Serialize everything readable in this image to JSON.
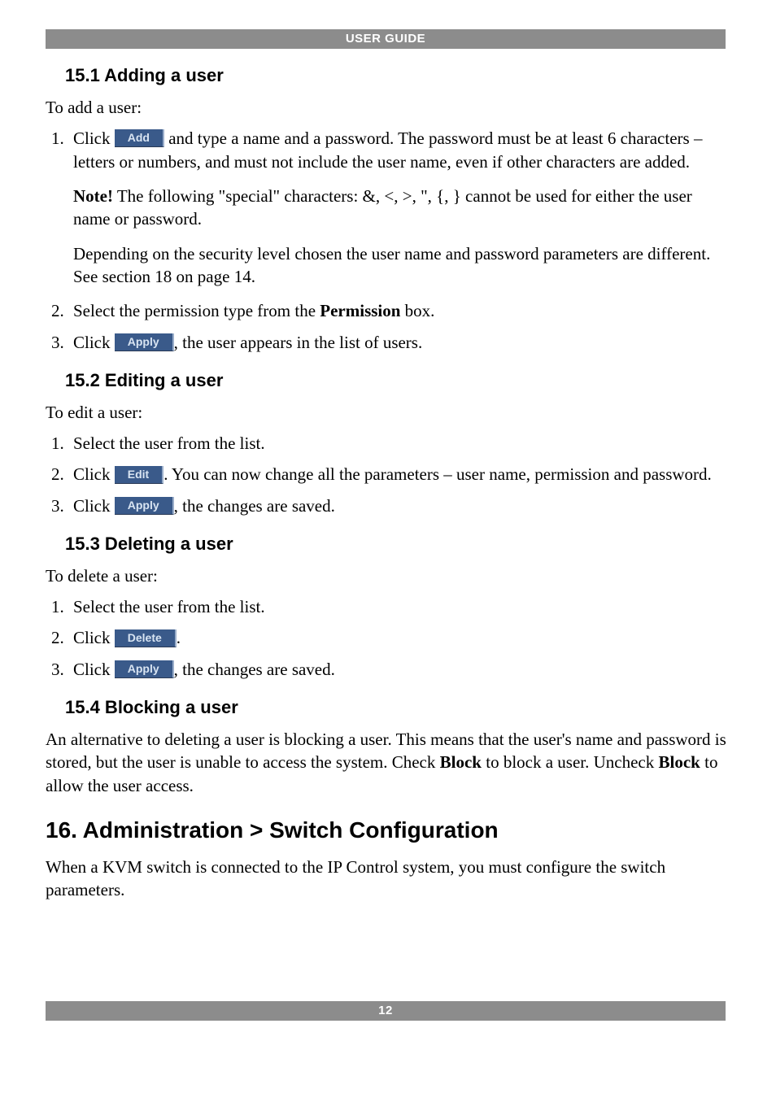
{
  "header": "USER GUIDE",
  "footer_page": "12",
  "s151": {
    "title": "15.1 Adding a user",
    "intro": "To add a user:",
    "step1_a": "Click ",
    "btn_add": "Add",
    "step1_b": " and type a name and a password. The password must be at least 6 characters – letters or numbers, and must not include the user name, even if other characters are added.",
    "note_label": "Note!",
    "note_body": " The following \"special\" characters: &, <, >, \", {, } cannot be used for either the user name or password.",
    "depend": "Depending on the security level chosen the user name and password parameters are different. See section 18 on page 14.",
    "step2_a": "Select the permission type from the ",
    "step2_perm": "Permission",
    "step2_b": " box.",
    "step3_a": "Click ",
    "btn_apply": "Apply",
    "step3_b": ", the user appears in the list of users."
  },
  "s152": {
    "title": "15.2 Editing a user",
    "intro": "To edit a user:",
    "step1": "Select the user from the list.",
    "step2_a": "Click ",
    "btn_edit": "Edit",
    "step2_b": ". You can now change all the parameters – user name, permission and password.",
    "step3_a": "Click ",
    "btn_apply": "Apply",
    "step3_b": ", the changes are saved."
  },
  "s153": {
    "title": "15.3 Deleting a user",
    "intro": "To delete a user:",
    "step1": "Select the user from the list.",
    "step2_a": "Click ",
    "btn_delete": "Delete",
    "step2_b": ".",
    "step3_a": "Click ",
    "btn_apply": "Apply",
    "step3_b": ", the changes are saved."
  },
  "s154": {
    "title": "15.4 Blocking a user",
    "body_a": "An alternative to deleting a user is blocking a user. This means that the user's name and password is stored, but the user is unable to access the system. Check ",
    "block1": "Block",
    "body_b": " to block a user. Uncheck ",
    "block2": "Block",
    "body_c": " to allow the user access."
  },
  "s16": {
    "title": "16. Administration > Switch Configuration",
    "body": "When a KVM switch is connected to the IP Control system, you must configure the switch parameters."
  }
}
